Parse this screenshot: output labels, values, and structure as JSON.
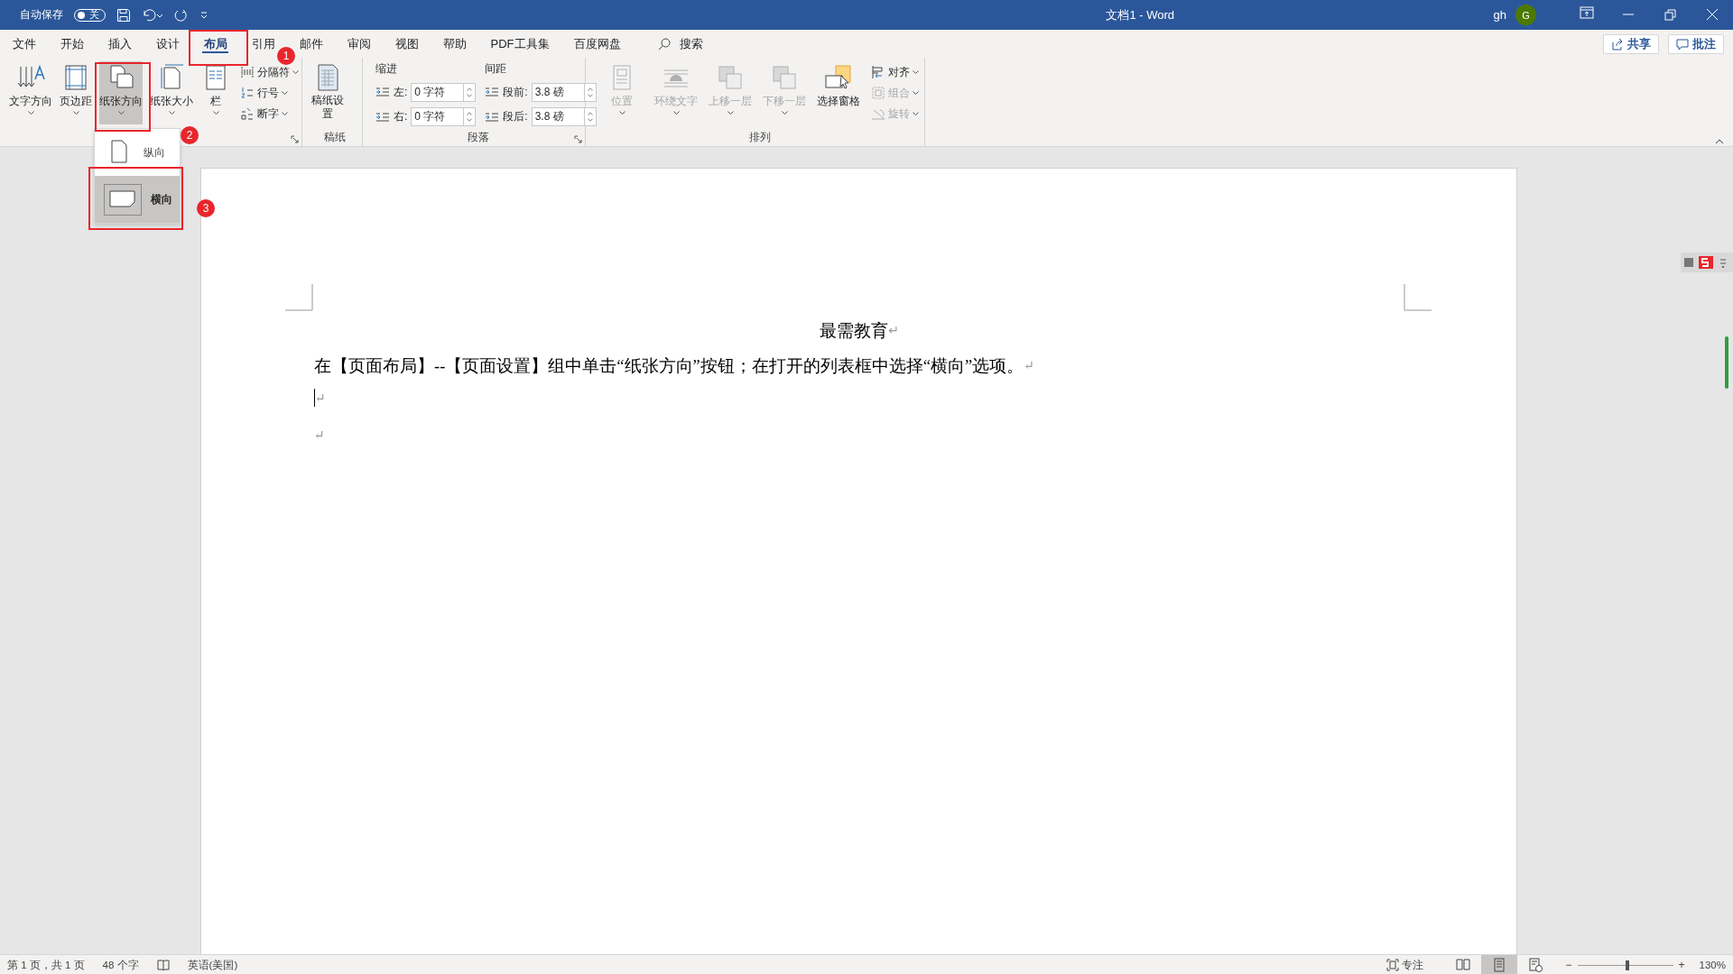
{
  "title_bar": {
    "autosave_label": "自动保存",
    "autosave_on": false,
    "autosave_state": "关",
    "title": "文档1  -  Word",
    "user": "gh",
    "avatar": "G"
  },
  "tabs": [
    {
      "label": "文件",
      "selected": false
    },
    {
      "label": "开始",
      "selected": false
    },
    {
      "label": "插入",
      "selected": false
    },
    {
      "label": "设计",
      "selected": false
    },
    {
      "label": "布局",
      "selected": true
    },
    {
      "label": "引用",
      "selected": false
    },
    {
      "label": "邮件",
      "selected": false
    },
    {
      "label": "审阅",
      "selected": false
    },
    {
      "label": "视图",
      "selected": false
    },
    {
      "label": "帮助",
      "selected": false
    },
    {
      "label": "PDF工具集",
      "selected": false
    },
    {
      "label": "百度网盘",
      "selected": false
    }
  ],
  "search": "搜索",
  "share_button": "共享",
  "comments_button": "批注",
  "page_setup": {
    "large_buttons": [
      {
        "label": "文字方向",
        "selected": false
      },
      {
        "label": "页边距",
        "selected": false
      },
      {
        "label": "纸张方向",
        "selected": true
      },
      {
        "label": "纸张大小",
        "selected": false
      },
      {
        "label": "栏",
        "selected": false
      }
    ],
    "small_buttons": [
      "分隔符",
      "行号",
      "断字"
    ]
  },
  "draft": {
    "button": "稿纸设置",
    "label": "稿纸"
  },
  "paragraph": {
    "indent_label": "缩进",
    "spacing_label": "间距",
    "indent": [
      {
        "label": "左:",
        "value": "0 字符"
      },
      {
        "label": "右:",
        "value": "0 字符"
      }
    ],
    "spacing": [
      {
        "label": "段前:",
        "value": "3.8 磅"
      },
      {
        "label": "段后:",
        "value": "3.8 磅"
      }
    ],
    "label": "段落"
  },
  "arrange": {
    "large_buttons": [
      {
        "label": "位置",
        "disabled": true
      },
      {
        "label": "环绕文字",
        "disabled": true
      },
      {
        "label": "上移一层",
        "disabled": true
      },
      {
        "label": "下移一层",
        "disabled": true
      },
      {
        "label": "选择窗格",
        "disabled": false
      }
    ],
    "small_buttons": [
      {
        "label": "对齐",
        "disabled": false
      },
      {
        "label": "组合",
        "disabled": true
      },
      {
        "label": "旋转",
        "disabled": true
      }
    ],
    "label": "排列"
  },
  "orientation_menu": [
    {
      "label": "纵向",
      "selected": false
    },
    {
      "label": "横向",
      "selected": true
    }
  ],
  "document": [
    {
      "kind": "heading",
      "text": "最需教育",
      "mark": "↵",
      "cursor": false
    },
    {
      "kind": "body",
      "text": "在【页面布局】--【页面设置】组中单击“纸张方向”按钮；在打开的列表框中选择“横向”选项。",
      "mark": "↵",
      "cursor": false
    },
    {
      "kind": "body",
      "mark": "↵",
      "cursor": true
    },
    {
      "kind": "body",
      "mark": "↵",
      "cursor": false
    }
  ],
  "status_bar": {
    "page": "第 1 页，共 1 页",
    "words": "48 个字",
    "language": "英语(美国)",
    "focus": "专注",
    "views": [
      {
        "kind": "read",
        "selected": false
      },
      {
        "kind": "print",
        "selected": true
      },
      {
        "kind": "web",
        "selected": false
      }
    ],
    "zoom_out": "−",
    "zoom_in": "+",
    "zoom": {
      "level": 0.5
    },
    "zoom_text": "130%"
  },
  "annotations": [
    {
      "label": "1"
    },
    {
      "label": "2"
    },
    {
      "label": "3"
    }
  ]
}
